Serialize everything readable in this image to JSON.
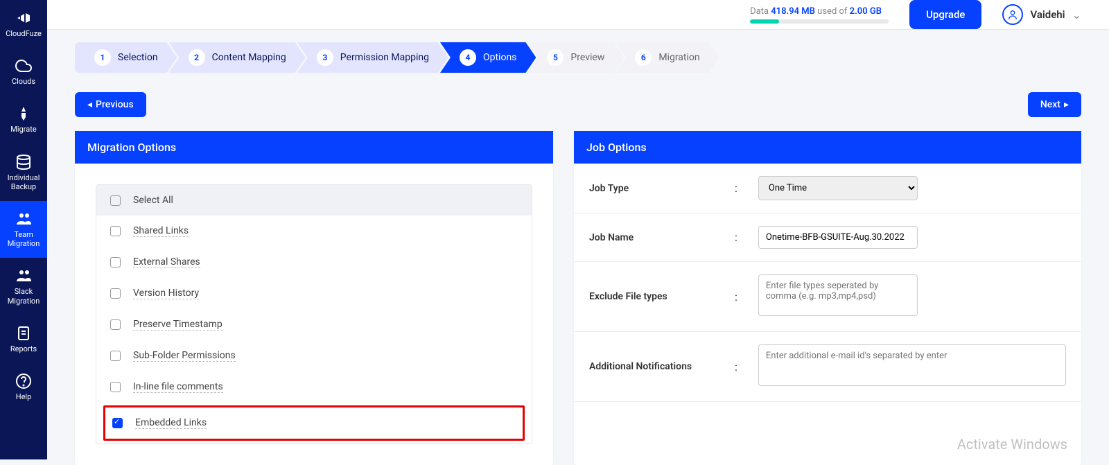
{
  "sidebar": {
    "items": [
      {
        "label": "CloudFuze",
        "icon": "logo"
      },
      {
        "label": "Clouds",
        "icon": "cloud"
      },
      {
        "label": "Migrate",
        "icon": "rocket"
      },
      {
        "label": "Individual Backup",
        "icon": "database"
      },
      {
        "label": "Team Migration",
        "icon": "team"
      },
      {
        "label": "Slack Migration",
        "icon": "slack"
      },
      {
        "label": "Reports",
        "icon": "report"
      },
      {
        "label": "Help",
        "icon": "help"
      }
    ]
  },
  "header": {
    "data_label": "Data",
    "used_value": "418.94 MB",
    "used_of": "used of",
    "total_value": "2.00 GB",
    "progress_percent": 21,
    "upgrade_label": "Upgrade",
    "username": "Vaidehi"
  },
  "steps": [
    {
      "num": "1",
      "label": "Selection"
    },
    {
      "num": "2",
      "label": "Content Mapping"
    },
    {
      "num": "3",
      "label": "Permission Mapping"
    },
    {
      "num": "4",
      "label": "Options"
    },
    {
      "num": "5",
      "label": "Preview"
    },
    {
      "num": "6",
      "label": "Migration"
    }
  ],
  "nav": {
    "previous": "Previous",
    "next": "Next"
  },
  "migration_options": {
    "title": "Migration Options",
    "select_all": "Select All",
    "items": [
      {
        "label": "Shared Links",
        "checked": false
      },
      {
        "label": "External Shares",
        "checked": false
      },
      {
        "label": "Version History",
        "checked": false
      },
      {
        "label": "Preserve Timestamp",
        "checked": false
      },
      {
        "label": "Sub-Folder Permissions",
        "checked": false
      },
      {
        "label": "In-line file comments",
        "checked": false
      },
      {
        "label": "Embedded Links",
        "checked": true
      }
    ]
  },
  "job_options": {
    "title": "Job Options",
    "rows": [
      {
        "label": "Job Type",
        "type": "select",
        "value": "One Time"
      },
      {
        "label": "Job Name",
        "type": "text",
        "value": "Onetime-BFB-GSUITE-Aug.30.2022"
      },
      {
        "label": "Exclude File types",
        "type": "textarea",
        "placeholder": "Enter file types seperated by comma (e.g. mp3,mp4,psd)"
      },
      {
        "label": "Additional Notifications",
        "type": "textarea_wide",
        "placeholder": "Enter additional e-mail id's separated by enter"
      }
    ]
  },
  "watermark": "Activate Windows"
}
